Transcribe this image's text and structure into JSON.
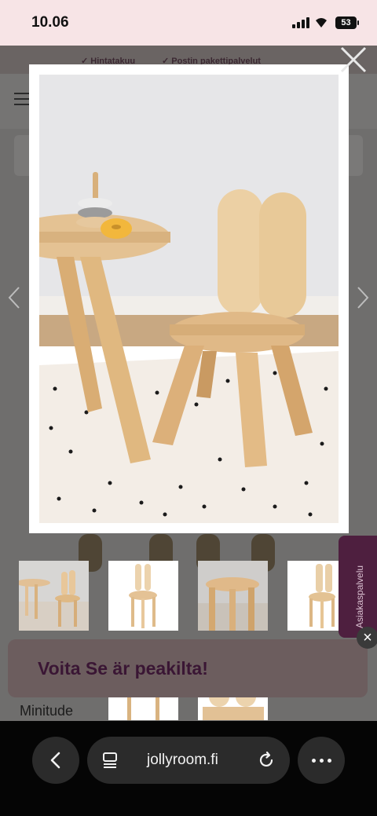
{
  "status_bar": {
    "time": "10.06",
    "battery": "53"
  },
  "usp_bar": {
    "items": [
      "✓ Hintatakuu",
      "✓ Postin pakettipalvelut"
    ]
  },
  "promo": {
    "text": "Voita Se        är       peakilta!"
  },
  "brand": {
    "name": "Minitude"
  },
  "support_tab": {
    "label": "Asiakaspalvelu"
  },
  "browser": {
    "url": "jollyroom.fi"
  },
  "icons": {
    "close": "close-icon",
    "prev": "chevron-left-icon",
    "next": "chevron-right-icon",
    "menu": "hamburger-menu-icon",
    "back": "back-icon",
    "tabs": "tabs-icon",
    "reload": "reload-icon",
    "more": "more-icon"
  },
  "colors": {
    "status_bg": "#f7e4e6",
    "promo_text": "#3a1634",
    "support_tab": "#4e1f3f"
  }
}
